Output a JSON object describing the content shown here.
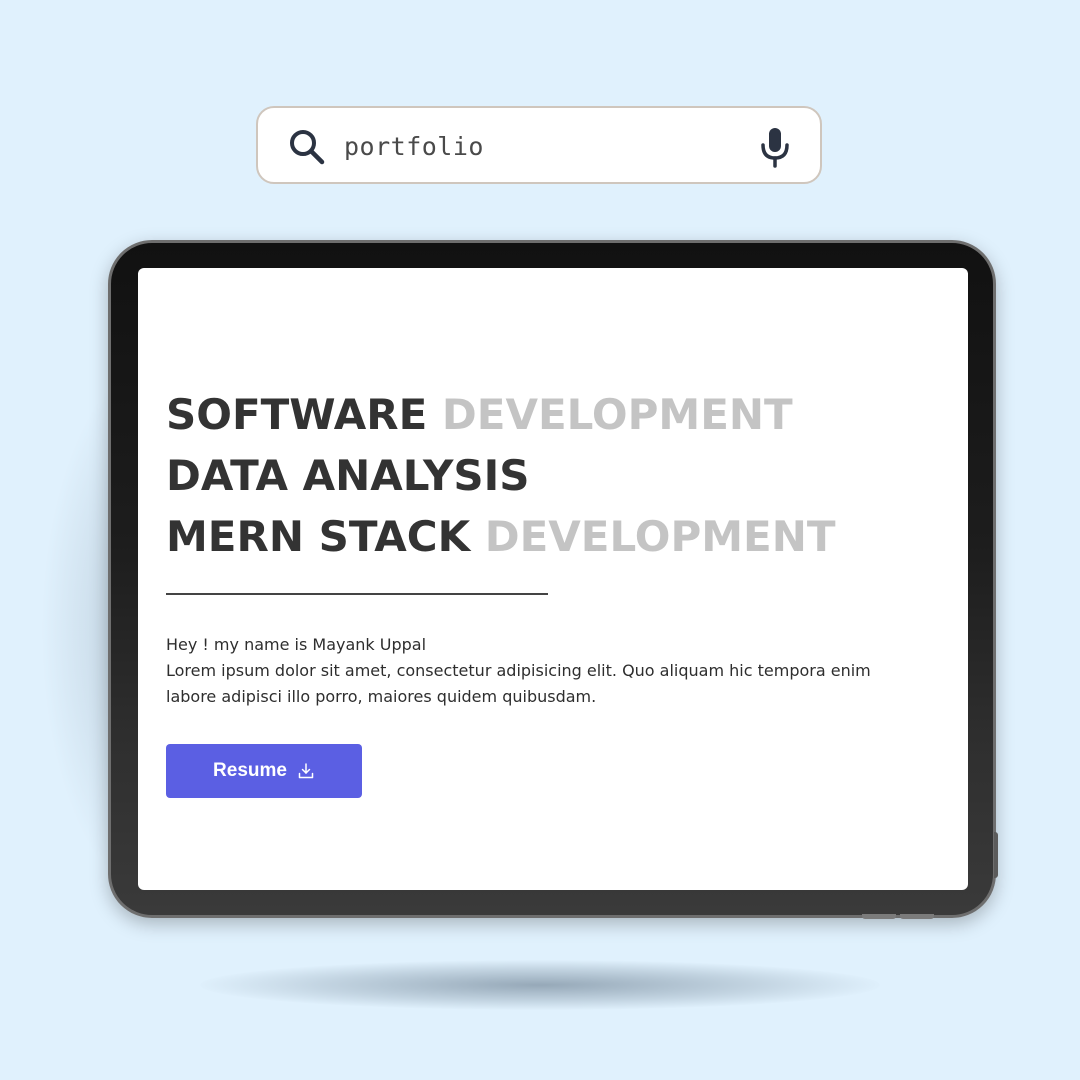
{
  "search": {
    "value": "portfolio",
    "search_icon": "search-icon",
    "mic_icon": "microphone-icon"
  },
  "hero": {
    "lines": [
      {
        "dark": "SOFTWARE",
        "light": "DEVELOPMENT"
      },
      {
        "dark": "DATA ANALYSIS",
        "light": ""
      },
      {
        "dark": "MERN STACK",
        "light": "DEVELOPMENT"
      }
    ],
    "greeting": "Hey ! my name is Mayank Uppal",
    "description": "Lorem ipsum dolor sit amet, consectetur adipisicing elit. Quo aliquam hic tempora enim labore adipisci illo porro, maiores quidem quibusdam.",
    "resume_label": "Resume",
    "resume_icon": "download-icon"
  },
  "colors": {
    "background": "#e0f1fd",
    "accent": "#5b5fe3",
    "headline_dark": "#333333",
    "headline_light": "#c4c4c4",
    "tablet_frame": "#1a1a1a"
  }
}
